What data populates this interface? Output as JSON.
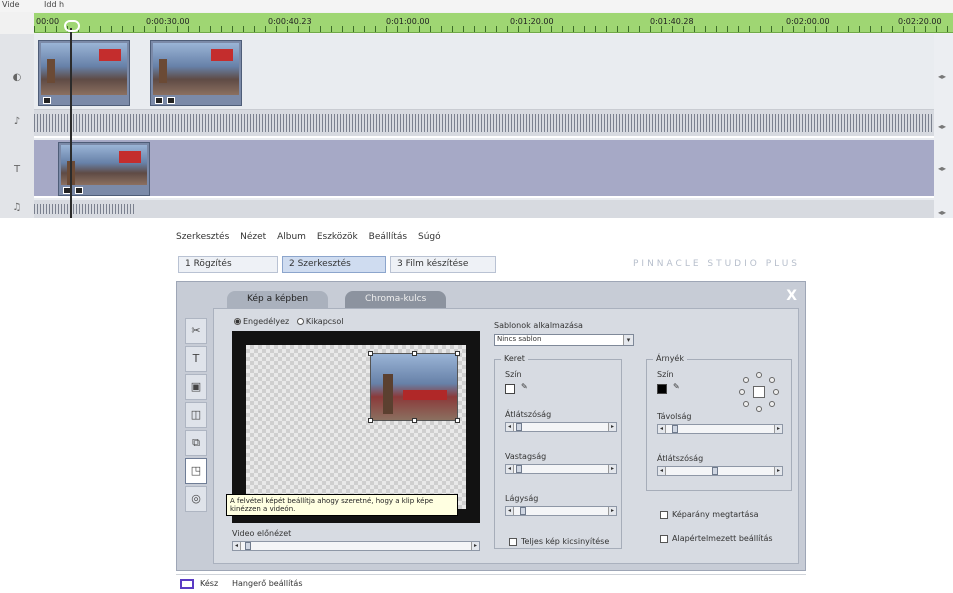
{
  "timeline": {
    "header_labels": [
      "Vide",
      "Idd h"
    ],
    "ruler_ticks": [
      "00:00",
      "0:00:30.00",
      "0:00:40.23",
      "0:01:00.00",
      "0:01:20.00",
      "0:01:40.28",
      "0:02:00.00",
      "0:02:20.00"
    ],
    "track_icons": [
      "video-track-icon",
      "audio-track-icon",
      "title-track-icon",
      "music-track-icon"
    ],
    "ruler_color": "#9fd673",
    "title_track_color": "#a6a9c6"
  },
  "menubar": {
    "items": [
      "Szerkesztés",
      "Nézet",
      "Album",
      "Eszközök",
      "Beállítás",
      "Súgó"
    ]
  },
  "main_tabs": [
    {
      "label": "1 Rögzítés"
    },
    {
      "label": "2 Szerkesztés"
    },
    {
      "label": "3 Film készítése"
    }
  ],
  "brand": "PINNACLE STUDIO PLUS",
  "panel": {
    "subtabs": [
      "Kép a képben",
      "Chroma-kulcs"
    ],
    "close_label": "X",
    "side_icons": [
      "video-toolbox-icon",
      "title-icon",
      "snapshot-icon",
      "audio-icon",
      "transition-icon",
      "pip-icon",
      "chroma-icon"
    ],
    "radio": {
      "option1": "Engedélyez",
      "option2": "Kikapcsol"
    },
    "template_label": "Sablonok alkalmazása",
    "template_value": "Nincs sablon",
    "border_group": {
      "title": "Keret",
      "color_label": "Szín",
      "transparency_label": "Átlátszóság",
      "thickness_label": "Vastagság",
      "width_label": "Lágyság"
    },
    "shadow_group": {
      "title": "Árnyék",
      "color_label": "Szín",
      "transparency_label": "Távolság",
      "blur_label": "Átlátszóság"
    },
    "checks": {
      "keep_aspect": "Képarány megtartása",
      "shrink_full": "Teljes kép kicsinyítése",
      "video_sharpen": "Alapértelmezett beállítás"
    },
    "video_label": "Video előnézet",
    "tooltip": "A felvétel képét beállítja ahogy szeretné, hogy a klip képe kinézzen a videón."
  },
  "status": {
    "text": "Kész",
    "extra": "Hangerő beállítás"
  }
}
